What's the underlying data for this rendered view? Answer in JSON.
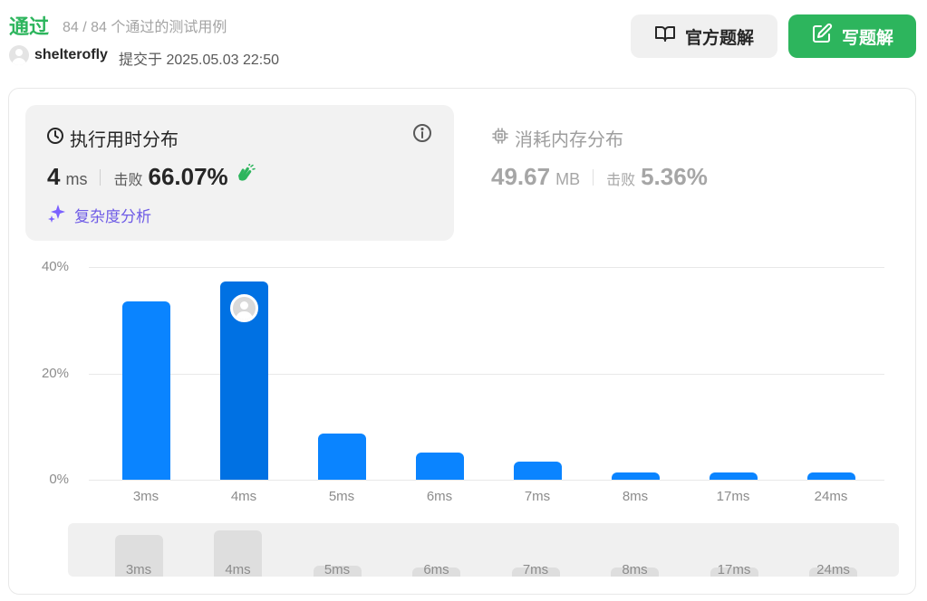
{
  "header": {
    "status": "通过",
    "cases_text": "84 / 84 个通过的测试用例",
    "username": "shelterofly",
    "submitted_text": "提交于 2025.05.03 22:50"
  },
  "buttons": {
    "official_solution": "官方题解",
    "write_solution": "写题解"
  },
  "runtime": {
    "title": "执行用时分布",
    "value": "4",
    "unit": "ms",
    "beats_label": "击败",
    "beats_value": "66.07%",
    "complexity_label": "复杂度分析"
  },
  "memory": {
    "title": "消耗内存分布",
    "value": "49.67",
    "unit": "MB",
    "beats_label": "击败",
    "beats_value": "5.36%"
  },
  "colors": {
    "accepted": "#2db55d",
    "bar": "#0a84ff",
    "bar_selected": "#0071e3",
    "complexity": "#6f5ce6"
  },
  "chart_data": {
    "type": "bar",
    "title": "",
    "xlabel": "",
    "ylabel": "",
    "categories": [
      "3ms",
      "4ms",
      "5ms",
      "6ms",
      "7ms",
      "8ms",
      "17ms",
      "24ms"
    ],
    "values": [
      33.6,
      37.2,
      8.6,
      5.1,
      3.4,
      1.3,
      1.3,
      1.3
    ],
    "selected_category": "4ms",
    "ylim": [
      0,
      40
    ],
    "yticks": [
      "0%",
      "20%",
      "40%"
    ],
    "grid": true
  }
}
